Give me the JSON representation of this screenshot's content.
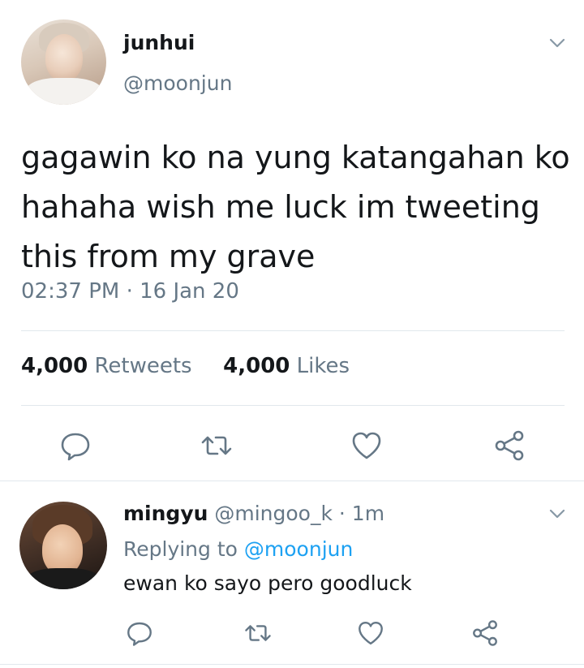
{
  "main_tweet": {
    "display_name": "junhui",
    "handle": "@moonjun",
    "text": "gagawin ko na yung katangahan ko hahaha wish me luck im tweeting this from my grave",
    "timestamp": "02:37 PM · 16 Jan 20",
    "retweet_count": "4,000",
    "retweet_label": "Retweets",
    "like_count": "4,000",
    "like_label": "Likes"
  },
  "reply_tweet": {
    "display_name": "mingyu",
    "meta": "@mingoo_k · 1m",
    "replying_prefix": "Replying to",
    "replying_handle": "@moonjun",
    "text": "ewan ko sayo pero goodluck"
  },
  "icons": {
    "chevron": "chevron-down-icon",
    "reply": "reply-icon",
    "retweet": "retweet-icon",
    "like": "heart-icon",
    "share": "share-icon"
  },
  "colors": {
    "text": "#14171a",
    "secondary": "#657786",
    "link": "#1da1f2",
    "divider": "#e1e8ed"
  }
}
